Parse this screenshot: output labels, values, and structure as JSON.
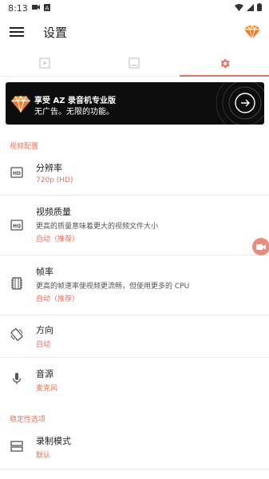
{
  "status": {
    "time": "8:13"
  },
  "appbar": {
    "title": "设置"
  },
  "promo": {
    "title": "享受 AZ 录音机专业版",
    "subtitle": "无广告。无限的功能。"
  },
  "sections": {
    "video": "视频配置",
    "stability": "稳定性选项"
  },
  "settings": [
    {
      "title": "分辨率",
      "desc": "",
      "value": "720p (HD)"
    },
    {
      "title": "视频质量",
      "desc": "更高的质量意味着更大的视频文件大小",
      "value": "自动（推荐）"
    },
    {
      "title": "帧率",
      "desc": "更高的帧速率使视频更流畅，但使用更多的 CPU",
      "value": "自动（推荐）"
    },
    {
      "title": "方向",
      "desc": "",
      "value": "自动"
    },
    {
      "title": "音源",
      "desc": "",
      "value": "麦克风"
    },
    {
      "title": "录制模式",
      "desc": "",
      "value": "默认"
    }
  ],
  "colors": {
    "accent": "#e8735a",
    "promo_bg": "#0d0d0d"
  }
}
